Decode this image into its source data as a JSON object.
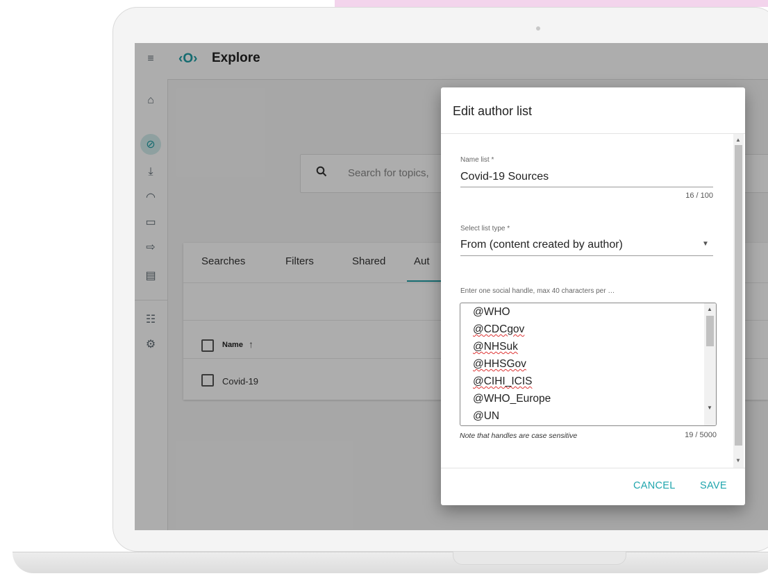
{
  "colors": {
    "accent": "#1f9ea5",
    "pink_banner": "#f3d4ec"
  },
  "sidebar": {
    "items": [
      {
        "icon": "menu-icon",
        "glyph": "≡"
      },
      {
        "icon": "home-icon",
        "glyph": "⌂"
      },
      {
        "icon": "compass-icon",
        "glyph": "⊘",
        "active": true
      },
      {
        "icon": "download-icon",
        "glyph": "⤓"
      },
      {
        "icon": "gauge-icon",
        "glyph": "◠"
      },
      {
        "icon": "comment-icon",
        "glyph": "▭"
      },
      {
        "icon": "share-icon",
        "glyph": "⇨"
      },
      {
        "icon": "document-icon",
        "glyph": "▤"
      },
      {
        "icon": "sliders-icon",
        "glyph": "☷"
      },
      {
        "icon": "gear-icon",
        "glyph": "⚙"
      }
    ]
  },
  "header": {
    "logo_glyph": "‹O›",
    "title": "Explore"
  },
  "search": {
    "placeholder": "Search for topics,"
  },
  "tabs": [
    "Searches",
    "Filters",
    "Shared",
    "Aut"
  ],
  "table": {
    "header": "Name",
    "rows": [
      "Covid-19"
    ]
  },
  "dialog": {
    "title": "Edit author list",
    "name_label": "Name list",
    "name_value": "Covid-19 Sources",
    "name_counter": "16 / 100",
    "type_label": "Select list type",
    "type_value": "From (content created by author)",
    "handles_label": "Enter one social handle, max 40 characters per …",
    "handles": [
      "@WHO",
      "@CDCgov",
      "@NHSuk",
      "@HHSGov",
      "@CIHI_ICIS",
      "@WHO_Europe",
      "@UN"
    ],
    "note": "Note that handles are case sensitive",
    "handles_counter": "19 / 5000",
    "cancel": "CANCEL",
    "save": "SAVE"
  }
}
